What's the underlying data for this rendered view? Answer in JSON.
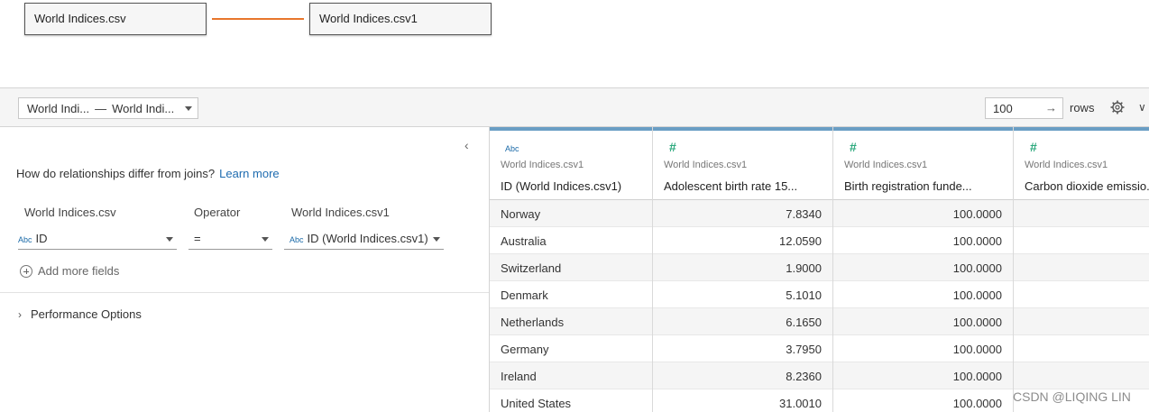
{
  "canvas": {
    "left_table": "World Indices.csv",
    "right_table": "World Indices.csv1",
    "relationship_color": "#e8762c"
  },
  "toolbar": {
    "table_select": {
      "left": "World Indi...",
      "separator": "—",
      "right": "World Indi..."
    },
    "rows_value": "100",
    "rows_arrow": "→",
    "rows_label": "rows"
  },
  "relationship": {
    "question": "How do relationships differ from joins?",
    "learn_more": "Learn more",
    "headers": {
      "left": "World Indices.csv",
      "operator": "Operator",
      "right": "World Indices.csv1"
    },
    "left_field": {
      "type": "Abc",
      "name": "ID"
    },
    "operator": "=",
    "right_field": {
      "type": "Abc",
      "name": "ID (World Indices.csv1)"
    },
    "add_more": "Add more fields",
    "performance": "Performance Options"
  },
  "grid": {
    "columns": [
      {
        "type": "Abc",
        "source": "World Indices.csv1",
        "name": "ID (World Indices.csv1)"
      },
      {
        "type": "#",
        "source": "World Indices.csv1",
        "name": "Adolescent birth rate 15..."
      },
      {
        "type": "#",
        "source": "World Indices.csv1",
        "name": "Birth registration funde..."
      },
      {
        "type": "#",
        "source": "World Indices.csv1",
        "name": "Carbon dioxide emissio..."
      }
    ],
    "rows": [
      [
        "Norway",
        "7.8340",
        "100.0000",
        ""
      ],
      [
        "Australia",
        "12.0590",
        "100.0000",
        ""
      ],
      [
        "Switzerland",
        "1.9000",
        "100.0000",
        ""
      ],
      [
        "Denmark",
        "5.1010",
        "100.0000",
        ""
      ],
      [
        "Netherlands",
        "6.1650",
        "100.0000",
        ""
      ],
      [
        "Germany",
        "3.7950",
        "100.0000",
        ""
      ],
      [
        "Ireland",
        "8.2360",
        "100.0000",
        ""
      ],
      [
        "United States",
        "31.0010",
        "100.0000",
        ""
      ]
    ]
  },
  "watermark": "CSDN @LIQING LIN"
}
